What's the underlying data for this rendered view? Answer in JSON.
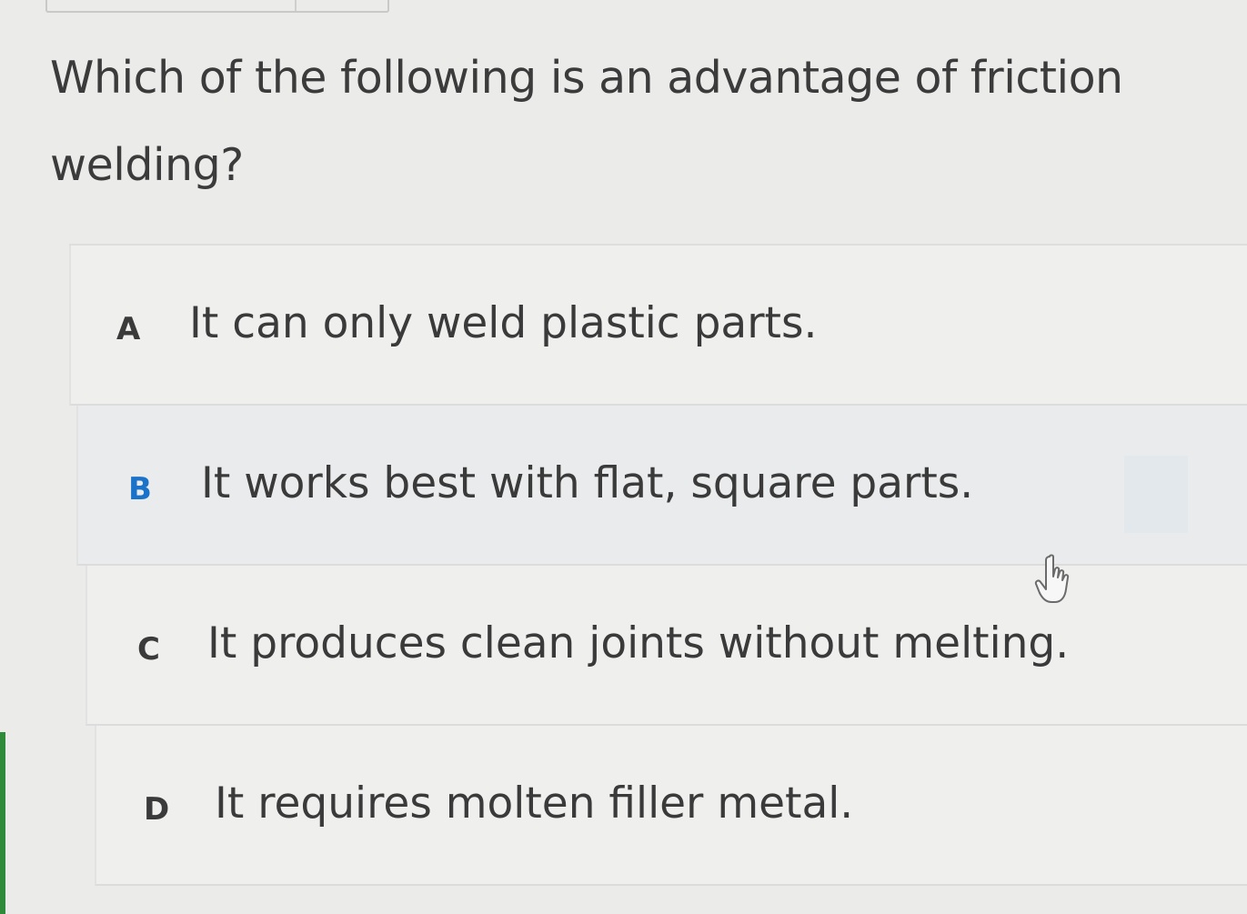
{
  "question": {
    "text": "Which of the following is an advantage of friction welding?"
  },
  "choices": [
    {
      "letter": "A",
      "text": "It can only weld plastic parts."
    },
    {
      "letter": "B",
      "text": "It works best with flat, square parts."
    },
    {
      "letter": "C",
      "text": "It produces clean joints without melting."
    },
    {
      "letter": "D",
      "text": "It requires molten filler metal."
    }
  ],
  "colors": {
    "selected_letter": "#1a73c9",
    "accent_left": "#2f8a3a"
  },
  "icons": {
    "cursor": "pointer-hand-icon"
  }
}
